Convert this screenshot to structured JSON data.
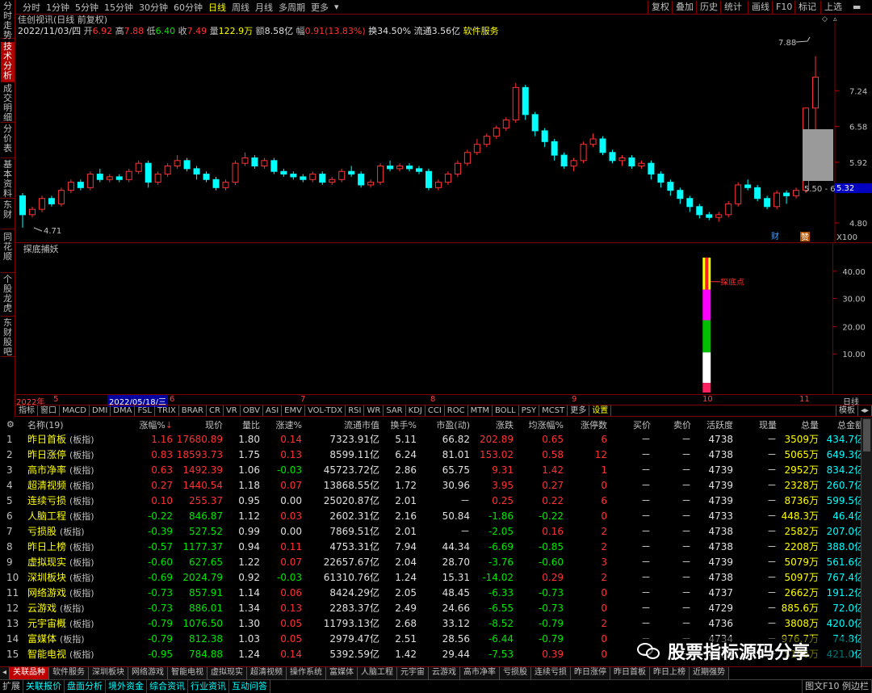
{
  "left_tabs": [
    "分时走势",
    "技术分析",
    "成交明细",
    "分价表",
    "基本资料",
    "东财",
    "同花顺",
    "个股龙虎",
    "东财股吧"
  ],
  "period_tabs": [
    "分时",
    "1分钟",
    "5分钟",
    "15分钟",
    "30分钟",
    "60分钟",
    "日线",
    "周线",
    "月线",
    "多周期",
    "更多"
  ],
  "active_period": "日线",
  "right_buttons": [
    "复权",
    "叠加",
    "历史",
    "统计",
    "画线",
    "F10",
    "标记",
    "上选"
  ],
  "info": {
    "stock_line": "佳创视讯(日线 前复权)",
    "date": "2022/11/03/四",
    "open_label": "开",
    "open": "6.92",
    "high_label": "高",
    "high": "7.88",
    "low_label": "低",
    "low": "6.40",
    "close_label": "收",
    "close": "7.49",
    "vol_label": "量",
    "vol": "122.9万",
    "amt_label": "额",
    "amt": "8.58亿",
    "amp_label": "幅",
    "amp": "0.91(13.83%)",
    "turn": "换34.50%",
    "float": "流通3.56亿",
    "sector": "软件服务"
  },
  "price_axis": [
    "7.24",
    "6.58",
    "5.92",
    "4.80"
  ],
  "price_high_label": "7.88",
  "price_low_label": "4.71",
  "current_price_tag": "5.32",
  "range_label": "5.50 - 6",
  "chart_badges": [
    "财",
    "赞"
  ],
  "zoom_label": "X100",
  "indicator_title": "探底捕妖",
  "indicator_annotation": "探底点",
  "ind_axis": [
    "40.00",
    "30.00",
    "20.00",
    "10.00"
  ],
  "date_axis": [
    "2022年",
    "5",
    "2022/05/18/三",
    "6",
    "7",
    "8",
    "9",
    "10",
    "11"
  ],
  "date_axis_right": "日线",
  "indicator_tabs": [
    "指标",
    "窗口",
    "MACD",
    "DMI",
    "DMA",
    "FSL",
    "TRIX",
    "BRAR",
    "CR",
    "VR",
    "OBV",
    "ASI",
    "EMV",
    "VOL-TDX",
    "RSI",
    "WR",
    "SAR",
    "KDJ",
    "CCI",
    "ROC",
    "MTM",
    "BOLL",
    "PSY",
    "MCST",
    "更多",
    "设置"
  ],
  "indicator_tab_right": "模板",
  "table": {
    "headers": [
      "名称(19)",
      "涨幅%",
      "现价",
      "量比",
      "涨速%",
      "流通市值",
      "换手%",
      "市盈(动)",
      "涨跌",
      "均涨幅%",
      "涨停数",
      "买价",
      "卖价",
      "活跃度",
      "现量",
      "总量",
      "总金额"
    ],
    "rows": [
      {
        "i": "1",
        "name": "昨日首板",
        "tag": "(板指)",
        "chg": "1.16",
        "price": "17680.89",
        "vr": "1.80",
        "spd": "0.14",
        "mcap": "7323.91亿",
        "turn": "5.11",
        "pe": "66.82",
        "d": "202.89",
        "avg": "0.65",
        "lim": "6",
        "bid": "－",
        "ask": "－",
        "act": "4738",
        "cv": "－",
        "tv": "3509万",
        "amt": "434.7亿",
        "c": "r",
        "sc": "r",
        "dc": "r",
        "ac": "r"
      },
      {
        "i": "2",
        "name": "昨日涨停",
        "tag": "(板指)",
        "chg": "0.83",
        "price": "18593.73",
        "vr": "1.75",
        "spd": "0.13",
        "mcap": "8599.11亿",
        "turn": "6.24",
        "pe": "81.01",
        "d": "153.02",
        "avg": "0.58",
        "lim": "12",
        "bid": "－",
        "ask": "－",
        "act": "4738",
        "cv": "－",
        "tv": "5065万",
        "amt": "649.3亿",
        "c": "r",
        "sc": "r",
        "dc": "r",
        "ac": "r"
      },
      {
        "i": "3",
        "name": "高市净率",
        "tag": "(板指)",
        "chg": "0.63",
        "price": "1492.39",
        "vr": "1.06",
        "spd": "-0.03",
        "mcap": "45723.72亿",
        "turn": "2.86",
        "pe": "65.75",
        "d": "9.31",
        "avg": "1.42",
        "lim": "1",
        "bid": "－",
        "ask": "－",
        "act": "4739",
        "cv": "－",
        "tv": "2952万",
        "amt": "834.2亿",
        "c": "r",
        "sc": "g",
        "dc": "r",
        "ac": "r"
      },
      {
        "i": "4",
        "name": "超清视频",
        "tag": "(板指)",
        "chg": "0.27",
        "price": "1440.54",
        "vr": "1.18",
        "spd": "0.07",
        "mcap": "13868.55亿",
        "turn": "1.72",
        "pe": "30.96",
        "d": "3.95",
        "avg": "0.27",
        "lim": "0",
        "bid": "－",
        "ask": "－",
        "act": "4739",
        "cv": "－",
        "tv": "2328万",
        "amt": "260.7亿",
        "c": "r",
        "sc": "r",
        "dc": "r",
        "ac": "r"
      },
      {
        "i": "5",
        "name": "连续亏损",
        "tag": "(板指)",
        "chg": "0.10",
        "price": "255.37",
        "vr": "0.95",
        "spd": "0.00",
        "mcap": "25020.87亿",
        "turn": "2.01",
        "pe": "－",
        "d": "0.25",
        "avg": "0.22",
        "lim": "6",
        "bid": "－",
        "ask": "－",
        "act": "4739",
        "cv": "－",
        "tv": "8736万",
        "amt": "599.5亿",
        "c": "r",
        "sc": "w",
        "dc": "r",
        "ac": "r"
      },
      {
        "i": "6",
        "name": "人脑工程",
        "tag": "(板指)",
        "chg": "-0.22",
        "price": "846.87",
        "vr": "1.12",
        "spd": "0.03",
        "mcap": "2602.31亿",
        "turn": "2.16",
        "pe": "50.84",
        "d": "-1.86",
        "avg": "-0.22",
        "lim": "0",
        "bid": "－",
        "ask": "－",
        "act": "4733",
        "cv": "－",
        "tv": "448.3万",
        "amt": "46.4亿",
        "c": "g",
        "sc": "r",
        "dc": "g",
        "ac": "g"
      },
      {
        "i": "7",
        "name": "亏损股",
        "tag": "(板指)",
        "chg": "-0.39",
        "price": "527.52",
        "vr": "0.99",
        "spd": "0.00",
        "mcap": "7869.51亿",
        "turn": "2.01",
        "pe": "－",
        "d": "-2.05",
        "avg": "0.16",
        "lim": "2",
        "bid": "－",
        "ask": "－",
        "act": "4738",
        "cv": "－",
        "tv": "2582万",
        "amt": "207.0亿",
        "c": "g",
        "sc": "w",
        "dc": "g",
        "ac": "r"
      },
      {
        "i": "8",
        "name": "昨日上榜",
        "tag": "(板指)",
        "chg": "-0.57",
        "price": "1177.37",
        "vr": "0.94",
        "spd": "0.11",
        "mcap": "4753.31亿",
        "turn": "7.94",
        "pe": "44.34",
        "d": "-6.69",
        "avg": "-0.85",
        "lim": "2",
        "bid": "－",
        "ask": "－",
        "act": "4738",
        "cv": "－",
        "tv": "2208万",
        "amt": "388.0亿",
        "c": "g",
        "sc": "r",
        "dc": "g",
        "ac": "g"
      },
      {
        "i": "9",
        "name": "虚拟现实",
        "tag": "(板指)",
        "chg": "-0.60",
        "price": "627.65",
        "vr": "1.22",
        "spd": "0.07",
        "mcap": "22657.67亿",
        "turn": "2.04",
        "pe": "28.70",
        "d": "-3.76",
        "avg": "-0.60",
        "lim": "3",
        "bid": "－",
        "ask": "－",
        "act": "4739",
        "cv": "－",
        "tv": "5079万",
        "amt": "561.6亿",
        "c": "g",
        "sc": "r",
        "dc": "g",
        "ac": "g"
      },
      {
        "i": "10",
        "name": "深圳板块",
        "tag": "(板指)",
        "chg": "-0.69",
        "price": "2024.79",
        "vr": "0.92",
        "spd": "-0.03",
        "mcap": "61310.76亿",
        "turn": "1.24",
        "pe": "15.31",
        "d": "-14.02",
        "avg": "0.29",
        "lim": "2",
        "bid": "－",
        "ask": "－",
        "act": "4738",
        "cv": "－",
        "tv": "5097万",
        "amt": "767.4亿",
        "c": "g",
        "sc": "g",
        "dc": "g",
        "ac": "r"
      },
      {
        "i": "11",
        "name": "网络游戏",
        "tag": "(板指)",
        "chg": "-0.73",
        "price": "857.91",
        "vr": "1.14",
        "spd": "0.06",
        "mcap": "8424.29亿",
        "turn": "2.05",
        "pe": "48.45",
        "d": "-6.33",
        "avg": "-0.73",
        "lim": "0",
        "bid": "－",
        "ask": "－",
        "act": "4737",
        "cv": "－",
        "tv": "2662万",
        "amt": "191.2亿",
        "c": "g",
        "sc": "r",
        "dc": "g",
        "ac": "g"
      },
      {
        "i": "12",
        "name": "云游戏",
        "tag": "(板指)",
        "chg": "-0.73",
        "price": "886.01",
        "vr": "1.34",
        "spd": "0.13",
        "mcap": "2283.37亿",
        "turn": "2.49",
        "pe": "24.66",
        "d": "-6.55",
        "avg": "-0.73",
        "lim": "0",
        "bid": "－",
        "ask": "－",
        "act": "4729",
        "cv": "－",
        "tv": "885.6万",
        "amt": "72.0亿",
        "c": "g",
        "sc": "r",
        "dc": "g",
        "ac": "g"
      },
      {
        "i": "13",
        "name": "元宇宙概",
        "tag": "(板指)",
        "chg": "-0.79",
        "price": "1076.50",
        "vr": "1.30",
        "spd": "0.05",
        "mcap": "11793.13亿",
        "turn": "2.68",
        "pe": "33.12",
        "d": "-8.52",
        "avg": "-0.79",
        "lim": "2",
        "bid": "－",
        "ask": "－",
        "act": "4736",
        "cv": "－",
        "tv": "3808万",
        "amt": "420.0亿",
        "c": "g",
        "sc": "r",
        "dc": "g",
        "ac": "g"
      },
      {
        "i": "14",
        "name": "富媒体",
        "tag": "(板指)",
        "chg": "-0.79",
        "price": "812.38",
        "vr": "1.03",
        "spd": "0.05",
        "mcap": "2979.47亿",
        "turn": "2.51",
        "pe": "28.56",
        "d": "-6.44",
        "avg": "-0.79",
        "lim": "0",
        "bid": "－",
        "ask": "－",
        "act": "4734",
        "cv": "－",
        "tv": "976.7万",
        "amt": "74.8亿",
        "c": "g",
        "sc": "r",
        "dc": "g",
        "ac": "g"
      },
      {
        "i": "15",
        "name": "智能电视",
        "tag": "(板指)",
        "chg": "-0.95",
        "price": "784.88",
        "vr": "1.24",
        "spd": "0.14",
        "mcap": "5392.59亿",
        "turn": "1.42",
        "pe": "29.44",
        "d": "-7.53",
        "avg": "0.39",
        "lim": "0",
        "bid": "－",
        "ask": "－",
        "act": "4734",
        "cv": "－",
        "tv": "5106万",
        "amt": "421.0亿",
        "c": "g",
        "sc": "r",
        "dc": "g",
        "ac": "r"
      }
    ]
  },
  "bottom_tabs": [
    "关联品种",
    "软件服务",
    "深圳板块",
    "网络游戏",
    "智能电视",
    "虚拟现实",
    "超清视频",
    "操作系统",
    "富媒体",
    "人脑工程",
    "元宇宙",
    "云游戏",
    "高市净率",
    "亏损股",
    "连续亏损",
    "昨日涨停",
    "昨日首板",
    "昨日上榜",
    "近期强势"
  ],
  "status_items": [
    "扩展",
    "关联报价",
    "盘面分析",
    "境外资金",
    "综合资讯",
    "行业资讯",
    "互动问答"
  ],
  "status_right": "图文F10  例边栏",
  "watermark_text": "股票指标源码分享",
  "chart_data": {
    "type": "candlestick",
    "title": "佳创视讯(日线 前复权)",
    "y_ticks": [
      4.8,
      5.92,
      6.58,
      7.24
    ],
    "ylim": [
      4.5,
      8.2
    ],
    "note_high": 7.88,
    "note_low": 4.71,
    "candles": [
      [
        5.3,
        4.95,
        5.35,
        4.71
      ],
      [
        4.95,
        5.05,
        5.1,
        4.9
      ],
      [
        5.05,
        5.25,
        5.3,
        5.0
      ],
      [
        5.25,
        5.15,
        5.3,
        5.1
      ],
      [
        5.15,
        5.4,
        5.45,
        5.1
      ],
      [
        5.4,
        5.55,
        5.6,
        5.35
      ],
      [
        5.55,
        5.45,
        5.6,
        5.4
      ],
      [
        5.45,
        5.7,
        5.75,
        5.4
      ],
      [
        5.7,
        5.6,
        5.8,
        5.55
      ],
      [
        5.6,
        5.65,
        5.7,
        5.55
      ],
      [
        5.65,
        5.6,
        5.7,
        5.55
      ],
      [
        5.6,
        5.75,
        5.8,
        5.55
      ],
      [
        5.75,
        5.9,
        5.95,
        5.7
      ],
      [
        5.9,
        5.55,
        5.95,
        5.45
      ],
      [
        5.55,
        5.7,
        5.75,
        5.5
      ],
      [
        5.7,
        5.85,
        5.9,
        5.65
      ],
      [
        5.85,
        5.95,
        6.05,
        5.8
      ],
      [
        5.95,
        5.8,
        6.0,
        5.75
      ],
      [
        5.8,
        5.7,
        5.85,
        5.6
      ],
      [
        5.7,
        5.6,
        5.75,
        5.55
      ],
      [
        5.6,
        5.45,
        5.65,
        5.4
      ],
      [
        5.45,
        5.55,
        5.6,
        5.4
      ],
      [
        5.55,
        5.9,
        5.95,
        5.5
      ],
      [
        5.9,
        6.0,
        6.1,
        5.85
      ],
      [
        6.0,
        5.85,
        6.05,
        5.8
      ],
      [
        5.85,
        5.95,
        6.0,
        5.8
      ],
      [
        5.95,
        5.75,
        6.0,
        5.7
      ],
      [
        5.75,
        5.7,
        5.8,
        5.65
      ],
      [
        5.7,
        5.65,
        5.75,
        5.6
      ],
      [
        5.65,
        5.6,
        5.7,
        5.55
      ],
      [
        5.6,
        5.7,
        5.75,
        5.55
      ],
      [
        5.7,
        5.55,
        5.75,
        5.5
      ],
      [
        5.55,
        5.6,
        5.65,
        5.5
      ],
      [
        5.6,
        5.75,
        5.8,
        5.55
      ],
      [
        5.75,
        5.7,
        5.85,
        5.65
      ],
      [
        5.7,
        5.5,
        5.75,
        5.45
      ],
      [
        5.5,
        5.55,
        5.6,
        5.45
      ],
      [
        5.55,
        5.85,
        5.9,
        5.5
      ],
      [
        5.85,
        5.8,
        5.95,
        5.75
      ],
      [
        5.8,
        5.85,
        5.9,
        5.75
      ],
      [
        5.85,
        5.8,
        5.9,
        5.75
      ],
      [
        5.8,
        5.75,
        5.85,
        5.7
      ],
      [
        5.75,
        5.45,
        5.8,
        5.4
      ],
      [
        5.45,
        5.55,
        5.6,
        5.4
      ],
      [
        5.55,
        5.7,
        5.75,
        5.5
      ],
      [
        5.7,
        5.9,
        5.95,
        5.65
      ],
      [
        5.9,
        6.1,
        6.15,
        5.85
      ],
      [
        6.1,
        6.25,
        6.35,
        6.05
      ],
      [
        6.25,
        6.4,
        6.45,
        6.2
      ],
      [
        6.4,
        6.55,
        6.6,
        6.35
      ],
      [
        6.55,
        6.7,
        6.75,
        6.5
      ],
      [
        6.7,
        7.3,
        7.38,
        6.65
      ],
      [
        7.3,
        6.8,
        7.35,
        6.7
      ],
      [
        6.8,
        6.5,
        6.85,
        6.4
      ],
      [
        6.5,
        6.3,
        6.55,
        6.2
      ],
      [
        6.3,
        6.05,
        6.35,
        5.95
      ],
      [
        6.05,
        5.85,
        6.1,
        5.8
      ],
      [
        5.85,
        5.95,
        6.0,
        5.75
      ],
      [
        5.95,
        6.25,
        6.3,
        5.9
      ],
      [
        6.25,
        6.35,
        6.45,
        6.2
      ],
      [
        6.35,
        6.1,
        6.4,
        6.05
      ],
      [
        6.1,
        5.95,
        6.15,
        5.9
      ],
      [
        5.95,
        6.0,
        6.05,
        5.85
      ],
      [
        6.0,
        5.85,
        6.05,
        5.8
      ],
      [
        5.85,
        5.9,
        5.95,
        5.8
      ],
      [
        5.9,
        5.7,
        5.95,
        5.6
      ],
      [
        5.7,
        5.55,
        5.75,
        5.45
      ],
      [
        5.55,
        5.4,
        5.6,
        5.3
      ],
      [
        5.4,
        5.25,
        5.45,
        5.15
      ],
      [
        5.25,
        5.1,
        5.3,
        5.0
      ],
      [
        5.1,
        4.95,
        5.15,
        4.88
      ],
      [
        4.95,
        4.9,
        5.0,
        4.85
      ],
      [
        4.9,
        4.95,
        5.0,
        4.82
      ],
      [
        4.95,
        5.15,
        5.2,
        4.9
      ],
      [
        5.15,
        5.5,
        5.55,
        5.1
      ],
      [
        5.5,
        5.45,
        5.6,
        5.4
      ],
      [
        5.45,
        5.25,
        5.5,
        5.2
      ],
      [
        5.25,
        5.1,
        5.3,
        5.05
      ],
      [
        5.1,
        5.35,
        5.4,
        5.05
      ],
      [
        5.35,
        5.3,
        5.4,
        5.15
      ],
      [
        5.3,
        5.4,
        5.45,
        5.25
      ],
      [
        5.4,
        6.92,
        6.92,
        5.35
      ],
      [
        6.92,
        7.49,
        7.88,
        6.4
      ]
    ]
  }
}
